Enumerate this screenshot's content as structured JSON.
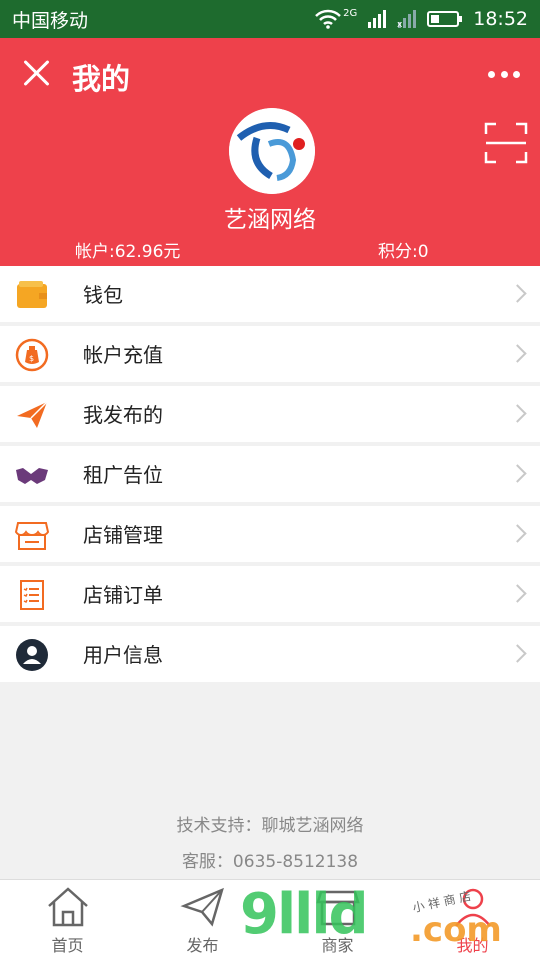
{
  "status": {
    "carrier": "中国移动",
    "network": "2G",
    "time": "18:52"
  },
  "header": {
    "title": "我的",
    "brand_name": "艺涵网络",
    "account_label": "帐户:62.96元",
    "points_label": "积分:0"
  },
  "menu": [
    {
      "label": "钱包",
      "icon": "wallet-icon",
      "color": "#f5a623"
    },
    {
      "label": "帐户充值",
      "icon": "money-bag-icon",
      "color": "#f26b21"
    },
    {
      "label": "我发布的",
      "icon": "paper-plane-icon",
      "color": "#f26b21"
    },
    {
      "label": "租广告位",
      "icon": "handshake-icon",
      "color": "#6b3a7a"
    },
    {
      "label": "店铺管理",
      "icon": "store-icon",
      "color": "#f26b21"
    },
    {
      "label": "店铺订单",
      "icon": "order-list-icon",
      "color": "#f26b21"
    },
    {
      "label": "用户信息",
      "icon": "user-icon",
      "color": "#1f2a38"
    }
  ],
  "footer": {
    "tech_support": "技术支持：聊城艺涵网络",
    "service": "客服：0635-8512138"
  },
  "tabs": [
    {
      "label": "首页",
      "icon": "home-icon"
    },
    {
      "label": "发布",
      "icon": "send-icon"
    },
    {
      "label": "商家",
      "icon": "shop-icon"
    },
    {
      "label": "我的",
      "icon": "profile-icon",
      "active": true
    }
  ],
  "watermark": {
    "main": "9llld",
    "domain": ".com",
    "tag": "小 祥 商 店"
  },
  "colors": {
    "header_red": "#ee414b",
    "status_green": "#1e6b2e"
  }
}
